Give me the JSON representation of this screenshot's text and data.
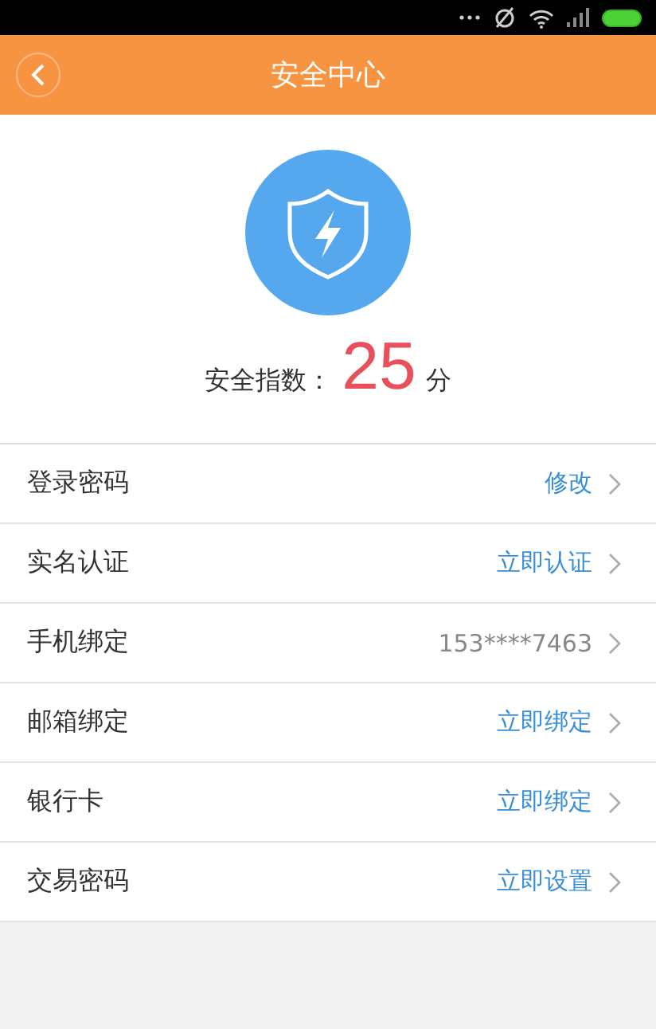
{
  "header": {
    "title": "安全中心"
  },
  "score": {
    "label": "安全指数：",
    "value": "25",
    "unit": "分"
  },
  "rows": [
    {
      "label": "登录密码",
      "value": "修改",
      "kind": "action"
    },
    {
      "label": "实名认证",
      "value": "立即认证",
      "kind": "action"
    },
    {
      "label": "手机绑定",
      "value": "153****7463",
      "kind": "info"
    },
    {
      "label": "邮箱绑定",
      "value": "立即绑定",
      "kind": "action"
    },
    {
      "label": "银行卡",
      "value": "立即绑定",
      "kind": "action"
    },
    {
      "label": "交易密码",
      "value": "立即设置",
      "kind": "action"
    }
  ]
}
